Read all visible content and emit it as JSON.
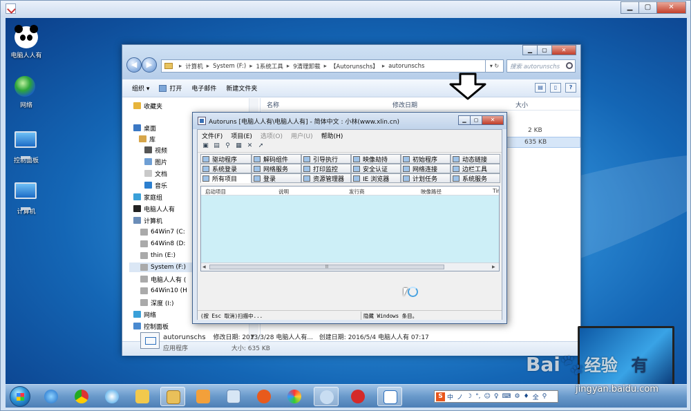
{
  "desktop": {
    "icons": [
      {
        "label": "电脑人人有"
      },
      {
        "label": "网络"
      },
      {
        "label": "控制面板"
      },
      {
        "label": "计算机"
      }
    ]
  },
  "explorer": {
    "address": [
      "计算机",
      "System (F:)",
      "1系统工具",
      "9清理卸载",
      "【Autorunschs】",
      "autorunschs"
    ],
    "search_placeholder": "搜索 autorunschs",
    "toolbar": {
      "organize": "组织 ▾",
      "open": "打开",
      "email": "电子邮件",
      "new_folder": "新建文件夹"
    },
    "nav": [
      {
        "label": "收藏夹",
        "color": "#e7b43b"
      },
      {
        "label": "桌面",
        "color": "#3b78c4"
      },
      {
        "label": "库",
        "color": "#d7a64a"
      },
      {
        "label": "视频",
        "color": "#555"
      },
      {
        "label": "图片",
        "color": "#6f9fd4"
      },
      {
        "label": "文档",
        "color": "#c9c9c9"
      },
      {
        "label": "音乐",
        "color": "#2c7fcf"
      },
      {
        "label": "家庭组",
        "color": "#3aa0d9"
      },
      {
        "label": "电脑人人有",
        "color": "#222"
      },
      {
        "label": "计算机",
        "color": "#6b8db8"
      },
      {
        "label": "64Win7  (C:",
        "color": "#aaa"
      },
      {
        "label": "64Win8  (D:",
        "color": "#aaa"
      },
      {
        "label": "thin (E:)",
        "color": "#aaa"
      },
      {
        "label": "System (F:)",
        "color": "#aaa"
      },
      {
        "label": "电脑人人有 (",
        "color": "#aaa"
      },
      {
        "label": "64Win10 (H",
        "color": "#aaa"
      },
      {
        "label": "深度 (I:)",
        "color": "#aaa"
      },
      {
        "label": "网络",
        "color": "#3aa0d9"
      },
      {
        "label": "控制面板",
        "color": "#4a8ad0"
      }
    ],
    "columns": {
      "name": "名称",
      "date": "修改日期",
      "size": "大小"
    },
    "rows": [
      {
        "size": "2 KB"
      },
      {
        "size": "635 KB"
      }
    ],
    "details": {
      "name": "autorunschs",
      "modified": "修改日期: 2013/3/28 电脑人人有...",
      "created": "创建日期: 2016/5/4 电脑人人有 07:17",
      "type": "应用程序",
      "size": "大小: 635 KB"
    }
  },
  "autoruns": {
    "title": "Autoruns [电脑人人有\\电脑人人有] - 简体中文 : 小林(www.xlin.cn)",
    "menu": [
      "文件(F)",
      "项目(E)",
      "选项(O)",
      "用户(U)",
      "帮助(H)"
    ],
    "tabs_row1": [
      "驱动程序",
      "解码组件",
      "引导执行",
      "映像劫持",
      "初始程序",
      "动态链接"
    ],
    "tabs_row2": [
      "系统登录",
      "网络服务",
      "打印监控",
      "安全认证",
      "网络连接",
      "边栏工具"
    ],
    "tabs_row3": [
      "所有项目",
      "登录",
      "资源管理器",
      "IE 浏览器",
      "计划任务",
      "系统服务"
    ],
    "list_columns": [
      "启动项目",
      "说明",
      "发行商",
      "映像路径",
      "Tim"
    ],
    "status_left": "(按 Esc 取消)扫描中...",
    "status_right": "隐藏 Windows 条目。"
  },
  "ime": {
    "items": [
      "中",
      "ノ",
      "☽",
      "°,",
      "☺",
      "♀",
      "⌨",
      "⚙",
      "♦",
      "全",
      "⚲"
    ]
  },
  "watermark": {
    "logo": "Bai",
    "logo_cn": "经验",
    "url": "jingyan.baidu.com",
    "laptop_text": "有"
  }
}
